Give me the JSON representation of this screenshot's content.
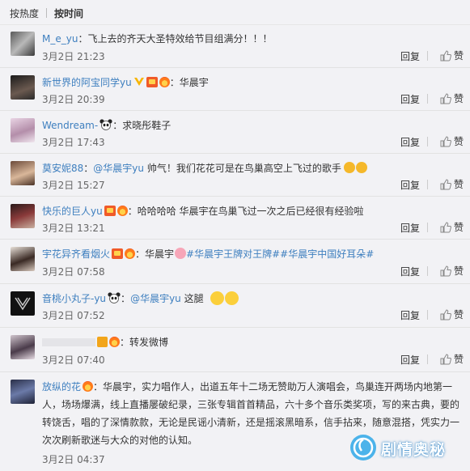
{
  "tabs": {
    "hot": "按热度",
    "time": "按时间"
  },
  "actions": {
    "reply": "回复",
    "like": "赞"
  },
  "comments": [
    {
      "user": "M_e_yu",
      "sep": "：",
      "text": "飞上去的齐天大圣特效给节目组满分！！！",
      "time": "3月2日 21:23"
    },
    {
      "user": "新世界的阿宝同学yu",
      "sep": "：",
      "text": "华晨宇",
      "time": "3月2日 20:39"
    },
    {
      "user": "Wendream-",
      "sep": "：",
      "text": "求晓彤鞋子",
      "time": "3月2日 17:43"
    },
    {
      "user": "莫安妮88",
      "sep": "：",
      "mention": "@华晨宇yu",
      "text": " 帅气！我们花花可是在鸟巢高空上飞过的歌手",
      "time": "3月2日 15:27"
    },
    {
      "user": "快乐的巨人yu",
      "sep": "：",
      "text": "哈哈哈哈 华晨宇在鸟巢飞过一次之后已经很有经验啦",
      "time": "3月2日 13:21"
    },
    {
      "user": "宇花异齐看烟火",
      "sep": "：",
      "text": "华晨宇",
      "topics": "#华晨宇王牌对王牌##华晨宇中国好耳朵#",
      "time": "3月2日 07:58"
    },
    {
      "user": "音桃小丸子-yu",
      "sep": "：",
      "mention": "@华晨宇yu",
      "text": " 这腿",
      "time": "3月2日 07:52"
    },
    {
      "user": "",
      "sep": "：",
      "text": "转发微博",
      "time": "3月2日 07:40"
    },
    {
      "user": "放纵的花",
      "sep": "：",
      "text": "华晨宇，实力唱作人，出道五年十二场无赞助万人演唱会，鸟巢连开两场内地第一人，场场爆满，线上直播屡破纪录，三张专辑首首精品，六十多个音乐类奖项，写的来古典，要的转饶舌，唱的了深情款款，无论是民谣小清新，还是摇滚黑暗系，信手拈来，随意混搭，凭实力一次次刷新歌迷与大众的对他的认知。",
      "time": "3月2日 04:37"
    }
  ],
  "watermark": {
    "text": "剧情奥秘"
  },
  "colors": {
    "link": "#3e7fbf",
    "background": "#f2f2f5",
    "divider": "#e2e2e2"
  }
}
